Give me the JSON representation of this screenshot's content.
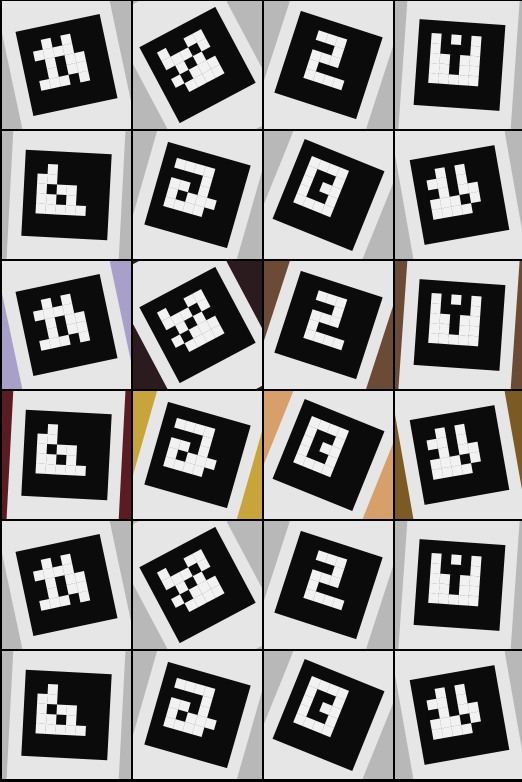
{
  "image": {
    "description_type": "grid of fiducial marker photographs",
    "rows": 6,
    "columns": 4,
    "tiles": [
      {
        "marker": "A",
        "background": "bg-gray",
        "row": 1,
        "col": 1
      },
      {
        "marker": "B",
        "background": "bg-gray",
        "row": 1,
        "col": 2
      },
      {
        "marker": "C",
        "background": "bg-gray",
        "row": 1,
        "col": 3
      },
      {
        "marker": "D",
        "background": "bg-gray",
        "row": 1,
        "col": 4
      },
      {
        "marker": "E",
        "background": "bg-gray",
        "row": 2,
        "col": 1
      },
      {
        "marker": "F",
        "background": "bg-gray",
        "row": 2,
        "col": 2
      },
      {
        "marker": "G",
        "background": "bg-gray",
        "row": 2,
        "col": 3
      },
      {
        "marker": "H",
        "background": "bg-gray",
        "row": 2,
        "col": 4
      },
      {
        "marker": "A",
        "background": "bg-purple",
        "row": 3,
        "col": 1
      },
      {
        "marker": "B",
        "background": "bg-dark",
        "row": 3,
        "col": 2
      },
      {
        "marker": "C",
        "background": "bg-brown",
        "row": 3,
        "col": 3
      },
      {
        "marker": "D",
        "background": "bg-brown",
        "row": 3,
        "col": 4
      },
      {
        "marker": "E",
        "background": "bg-red",
        "row": 4,
        "col": 1
      },
      {
        "marker": "F",
        "background": "bg-yellow",
        "row": 4,
        "col": 2
      },
      {
        "marker": "G",
        "background": "bg-orange",
        "row": 4,
        "col": 3
      },
      {
        "marker": "H",
        "background": "bg-amber",
        "row": 4,
        "col": 4
      },
      {
        "marker": "A",
        "background": "bg-gray",
        "row": 5,
        "col": 1
      },
      {
        "marker": "B",
        "background": "bg-gray",
        "row": 5,
        "col": 2
      },
      {
        "marker": "C",
        "background": "bg-gray",
        "row": 5,
        "col": 3
      },
      {
        "marker": "D",
        "background": "bg-gray",
        "row": 5,
        "col": 4
      },
      {
        "marker": "E",
        "background": "bg-gray",
        "row": 6,
        "col": 1
      },
      {
        "marker": "F",
        "background": "bg-gray",
        "row": 6,
        "col": 2
      },
      {
        "marker": "G",
        "background": "bg-gray",
        "row": 6,
        "col": 3
      },
      {
        "marker": "H",
        "background": "bg-gray",
        "row": 6,
        "col": 4
      }
    ]
  },
  "colors": {
    "border": "#000000",
    "marker_black": "#0b0b0b",
    "marker_white": "#f2f2f2",
    "bg_gray": "#b8b8b8",
    "bg_white": "#ffffff",
    "bg_purple": "#a9a0c9",
    "bg_dark": "#2b1a1e",
    "bg_brown": "#6b4a36",
    "bg_red": "#5a1c22",
    "bg_yellow": "#c8a53a",
    "bg_orange": "#d7a06a",
    "bg_amber": "#7c5a24"
  }
}
